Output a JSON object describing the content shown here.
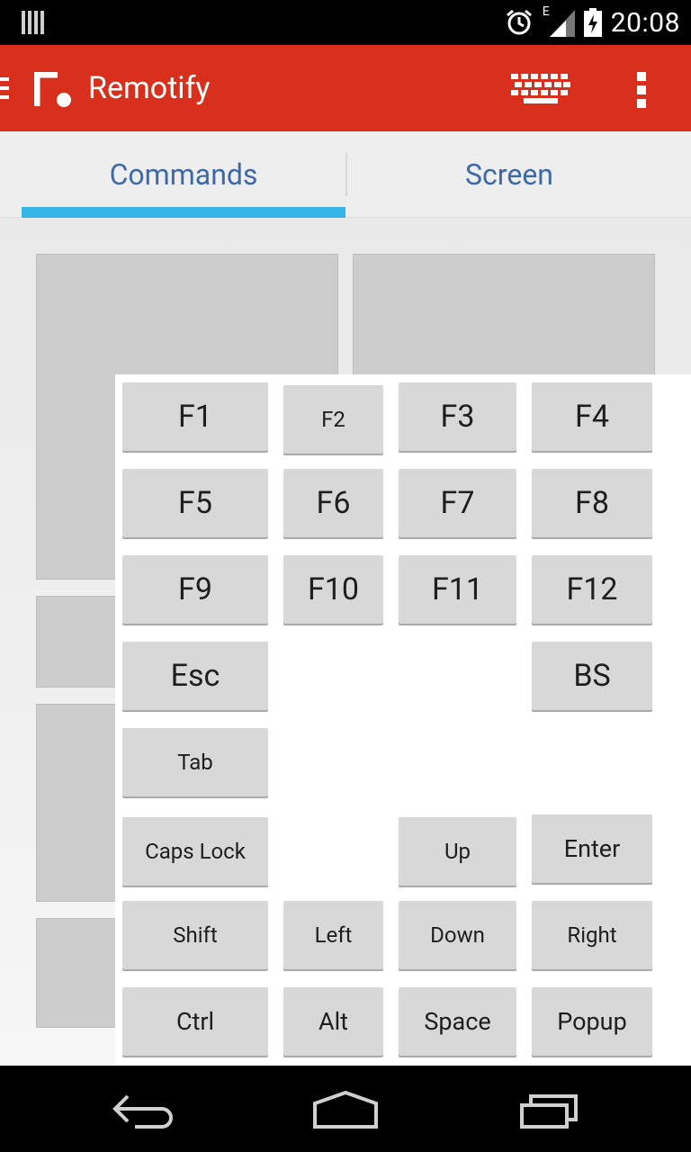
{
  "status_bar": {
    "time": "20:08",
    "network_label": "E",
    "icons": [
      "notification-bars-icon",
      "alarm-icon",
      "signal-icon",
      "battery-icon"
    ]
  },
  "app_bar": {
    "title": "Remotify",
    "accent_color": "#d9301e",
    "icons": [
      "drawer-icon",
      "remotify-logo",
      "keyboard-icon",
      "overflow-menu-icon"
    ]
  },
  "tabs": [
    {
      "label": "Commands",
      "selected": true
    },
    {
      "label": "Screen",
      "selected": false
    }
  ],
  "tab_indicator_color": "#33b5e5",
  "keyboard": {
    "keys": {
      "f1": "F1",
      "f2": "F2",
      "f3": "F3",
      "f4": "F4",
      "f5": "F5",
      "f6": "F6",
      "f7": "F7",
      "f8": "F8",
      "f9": "F9",
      "f10": "F10",
      "f11": "F11",
      "f12": "F12",
      "esc": "Esc",
      "bs": "BS",
      "tab": "Tab",
      "caps_lock": "Caps Lock",
      "up": "Up",
      "enter": "Enter",
      "shift": "Shift",
      "left": "Left",
      "down": "Down",
      "right": "Right",
      "ctrl": "Ctrl",
      "alt": "Alt",
      "space": "Space",
      "popup": "Popup"
    }
  },
  "nav_bar": {
    "icons": [
      "back-icon",
      "home-icon",
      "recent-apps-icon"
    ]
  }
}
